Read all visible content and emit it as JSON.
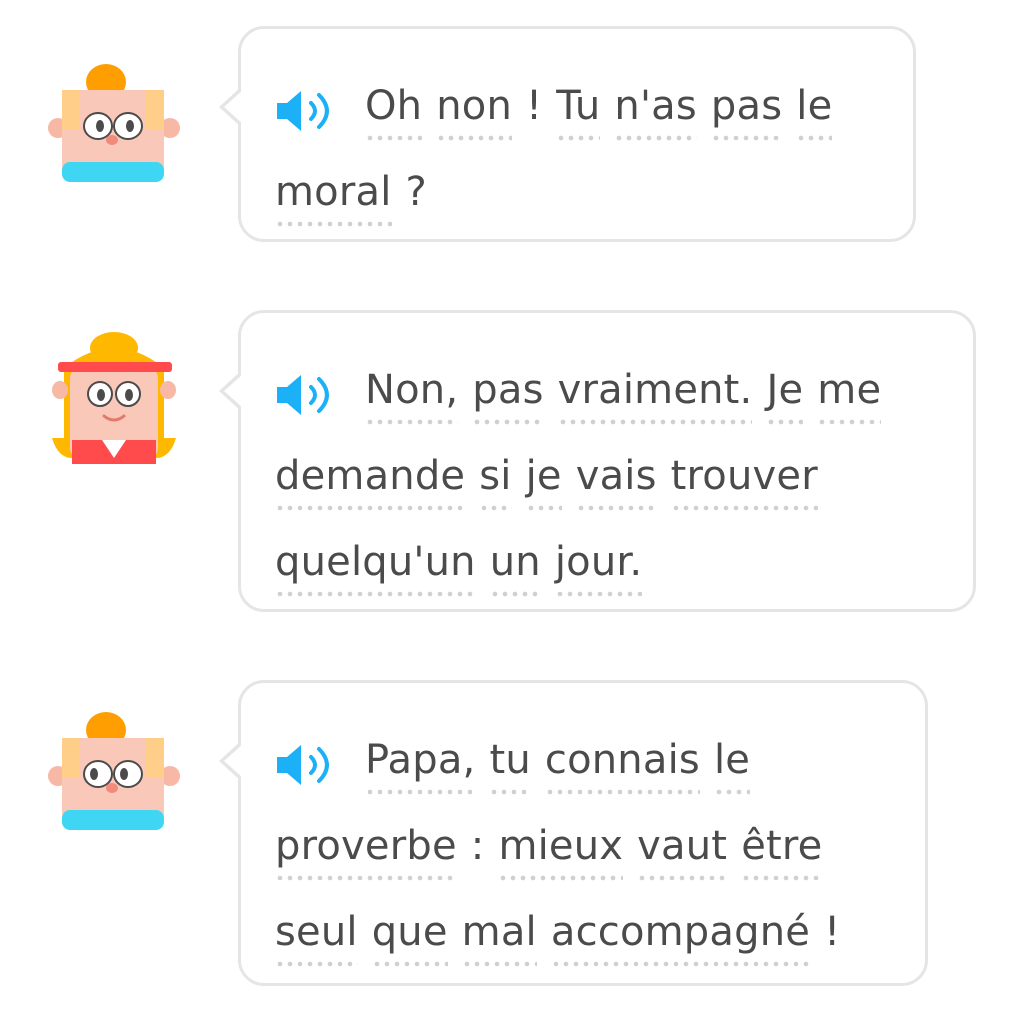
{
  "conversation": {
    "messages": [
      {
        "speaker": "boy-character",
        "speaker_icon": "speaker-icon",
        "lines": [
          [
            "Oh",
            "non",
            "!",
            "Tu",
            "n'as",
            "pas",
            "le"
          ],
          [
            "moral",
            "?"
          ]
        ]
      },
      {
        "speaker": "girl-character",
        "speaker_icon": "speaker-icon",
        "lines": [
          [
            "Non,",
            "pas",
            "vraiment.",
            "Je",
            "me"
          ],
          [
            "demande",
            "si",
            "je",
            "vais",
            "trouver"
          ],
          [
            "quelqu'un",
            "un",
            "jour."
          ]
        ]
      },
      {
        "speaker": "boy-character",
        "speaker_icon": "speaker-icon",
        "lines": [
          [
            "Papa,",
            "tu",
            "connais",
            "le"
          ],
          [
            "proverbe",
            ":",
            "mieux",
            "vaut",
            "être"
          ],
          [
            "seul",
            "que",
            "mal",
            "accompagné",
            "!"
          ]
        ]
      }
    ]
  },
  "colors": {
    "speaker_blue": "#1cb0f6",
    "bubble_border": "#e5e5e5",
    "text": "#4b4b4b",
    "dotted_underline": "#d0d0d0"
  }
}
